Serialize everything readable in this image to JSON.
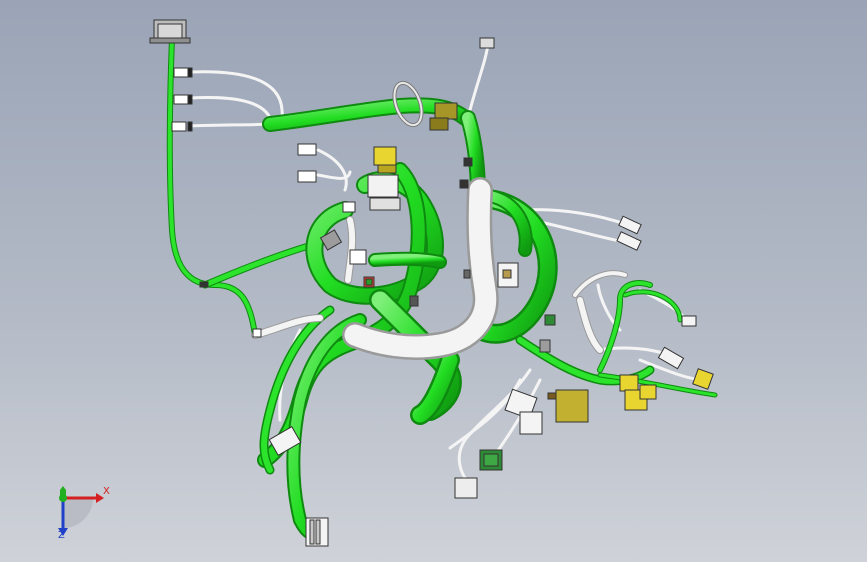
{
  "viewport": {
    "background_top": "#9aa4b6",
    "background_bottom": "#cfd2d8"
  },
  "harness": {
    "main_color": "#22dd22",
    "main_shade": "#118f11",
    "sheath_color": "#f2f2f2",
    "connector_white": "#ffffff",
    "connector_yellow": "#e8d530",
    "connector_olive": "#a69628",
    "connector_green": "#2f8a36",
    "clip_gray": "#8f8f8f"
  },
  "triad": {
    "x_label": "X",
    "z_label": "Z",
    "x_color": "#d42020",
    "y_color": "#20b020",
    "z_color": "#2040c8"
  }
}
